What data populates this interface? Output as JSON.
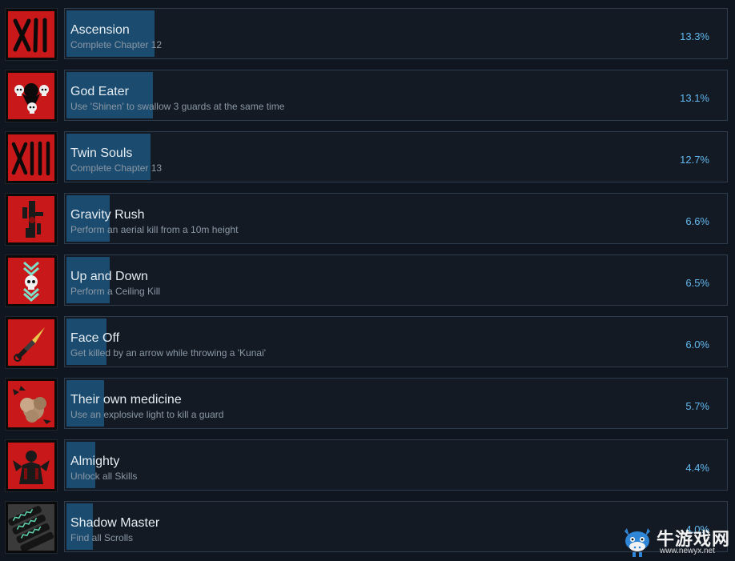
{
  "achievements": [
    {
      "title": "Ascension",
      "description": "Complete Chapter 12",
      "percent": "13.3%",
      "icon": "chapter-xii-icon",
      "fill_percent": 13.3
    },
    {
      "title": "God Eater",
      "description": "Use 'Shinen' to swallow 3 guards at the same time",
      "percent": "13.1%",
      "icon": "three-skulls-icon",
      "fill_percent": 13.1
    },
    {
      "title": "Twin Souls",
      "description": "Complete Chapter 13",
      "percent": "12.7%",
      "icon": "chapter-xiii-icon",
      "fill_percent": 12.7
    },
    {
      "title": "Gravity Rush",
      "description": "Perform an aerial kill from a 10m height",
      "percent": "6.6%",
      "icon": "falling-ninja-icon",
      "fill_percent": 6.6
    },
    {
      "title": "Up and Down",
      "description": "Perform a Ceiling Kill",
      "percent": "6.5%",
      "icon": "skull-arrows-icon",
      "fill_percent": 6.5
    },
    {
      "title": "Face Off",
      "description": "Get killed by an arrow while throwing a 'Kunai'",
      "percent": "6.0%",
      "icon": "kunai-icon",
      "fill_percent": 6.0
    },
    {
      "title": "Their own medicine",
      "description": "Use an explosive light to kill a guard",
      "percent": "5.7%",
      "icon": "explosion-icon",
      "fill_percent": 5.7
    },
    {
      "title": "Almighty",
      "description": "Unlock all Skills",
      "percent": "4.4%",
      "icon": "demon-silhouette-icon",
      "fill_percent": 4.4
    },
    {
      "title": "Shadow Master",
      "description": "Find all Scrolls",
      "percent": "4.0%",
      "icon": "scrolls-icon",
      "fill_percent": 4.0
    }
  ],
  "watermark": {
    "text_cn": "牛游戏网",
    "url": "www.newyx.net"
  },
  "colors": {
    "background": "#101620",
    "card": "#131a24",
    "card_border": "#2e3d4e",
    "progress_fill": "#1b4b6e",
    "percent_text": "#62b8ee",
    "icon_red": "#c8181a"
  }
}
